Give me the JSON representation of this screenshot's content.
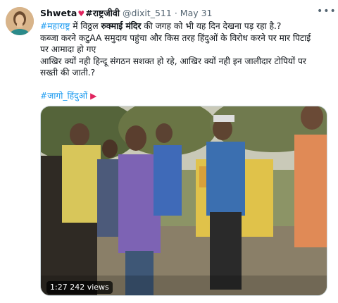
{
  "tweet": {
    "author_name": "Shweta",
    "author_name_suffix": "#राष्ट्रजीवी",
    "handle": "@dixit_511",
    "separator": "·",
    "date": "May 31",
    "more_icon": "more-horizontal-icon",
    "lines": {
      "l1_tag": "#महाराष्ट्र",
      "l1_a": " में विठ्ठल ",
      "l1_bold": "रुक्माई मंदिर",
      "l1_b": " की जगह को भी यह दिन देखना पड़ रहा है.?",
      "l2": "कब्जा करने कटुAA समुदाय पहुंचा और किस तरह हिंदुओं के विरोध करने पर मार पिटाई",
      "l3": "पर आमादा हो गए",
      "l4": "आखिर क्यों नही हिन्दू संगठन सशक्त हो रहे, आखिर क्यों नही इन जालीदार टोपियों पर",
      "l5": "सख्ती की जाती.?",
      "hashtag2": "#जागो_हिंदुओं"
    },
    "flag_icon": "triangular-flag-icon",
    "video": {
      "duration": "1:27",
      "views": "242 views"
    }
  }
}
